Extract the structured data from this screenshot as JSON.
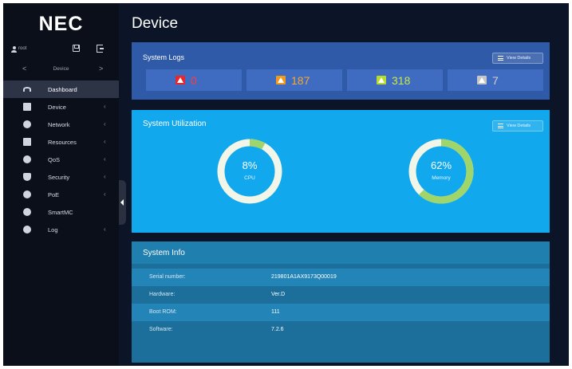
{
  "brand": {
    "logo": "NEC"
  },
  "user": {
    "name": "root"
  },
  "nav_switch": {
    "prev": "<",
    "label": "Device",
    "next": ">"
  },
  "menu": [
    {
      "label": "Dashboard",
      "icon": "gauge-icon",
      "active": true,
      "arrow": ""
    },
    {
      "label": "Device",
      "icon": "device-icon",
      "active": false,
      "arrow": "‹"
    },
    {
      "label": "Network",
      "icon": "globe-icon",
      "active": false,
      "arrow": "‹"
    },
    {
      "label": "Resources",
      "icon": "database-icon",
      "active": false,
      "arrow": "‹"
    },
    {
      "label": "QoS",
      "icon": "qos-icon",
      "active": false,
      "arrow": "‹"
    },
    {
      "label": "Security",
      "icon": "shield-icon",
      "active": false,
      "arrow": "‹"
    },
    {
      "label": "PoE",
      "icon": "poe-icon",
      "active": false,
      "arrow": "‹"
    },
    {
      "label": "SmartMC",
      "icon": "smartmc-icon",
      "active": false,
      "arrow": ""
    },
    {
      "label": "Log",
      "icon": "log-icon",
      "active": false,
      "arrow": "‹"
    }
  ],
  "page": {
    "title": "Device"
  },
  "system_logs": {
    "title": "System Logs",
    "view_details": "View Details",
    "counts": [
      {
        "value": "0",
        "icon_color": "#e8262b",
        "text_color": "#ff3b3b"
      },
      {
        "value": "187",
        "icon_color": "#f29a1e",
        "text_color": "#f7a733"
      },
      {
        "value": "318",
        "icon_color": "#b7dd2a",
        "text_color": "#c6e84a"
      },
      {
        "value": "7",
        "icon_color": "#c6c6c6",
        "text_color": "#d0d0d0"
      }
    ]
  },
  "system_utilization": {
    "title": "System Utilization",
    "view_details": "View Details",
    "cpu": {
      "percent": 8,
      "label": "8%",
      "caption": "CPU"
    },
    "memory": {
      "percent": 62,
      "label": "62%",
      "caption": "Memory"
    },
    "ring_color": "#f2f6e8",
    "fill_color": "#9fd56b"
  },
  "system_info": {
    "title": "System Info",
    "rows": [
      {
        "key": "Serial number:",
        "value": "219801A1AX9173Q00019"
      },
      {
        "key": "Hardware:",
        "value": "Ver.D"
      },
      {
        "key": "Boot ROM:",
        "value": "111"
      },
      {
        "key": "Software:",
        "value": "7.2.6"
      }
    ]
  }
}
